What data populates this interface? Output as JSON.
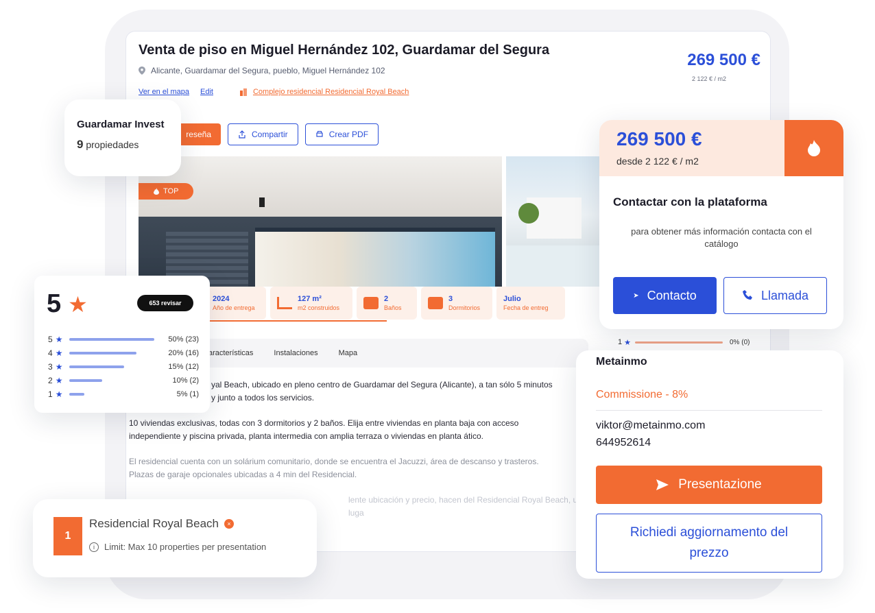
{
  "listing": {
    "title": "Venta de piso en Miguel Hernández 102, Guardamar del Segura",
    "address": "Alicante, Guardamar del Segura, pueblo, Miguel Hernández 102",
    "link_map": "Ver en el mapa",
    "link_edit": "Edit",
    "link_complex": "Complejo residencial Residencial Royal Beach",
    "price": "269 500 €",
    "price_m2": "2 122 € / m2",
    "btn_review": "reseña",
    "btn_share": "Compartir",
    "btn_pdf": "Crear PDF",
    "top_badge": "TOP"
  },
  "features": [
    {
      "value": "2024",
      "label": "Año de entrega",
      "icon": "calendar-icon"
    },
    {
      "value": "127 m²",
      "label": "m2 construidos",
      "icon": "area-icon"
    },
    {
      "value": "2",
      "label": "Baños",
      "icon": "bath-icon"
    },
    {
      "value": "3",
      "label": "Dormitorios",
      "icon": "bed-icon"
    },
    {
      "value": "Julio",
      "label": "Fecha de entreg",
      "icon": "date-icon"
    }
  ],
  "tabs": [
    "aracterísticas",
    "Instalaciones",
    "Mapa"
  ],
  "description": {
    "p1a": "yal Beach, ubicado en pleno centro de Guardamar del Segura (Alicante), a tan sólo 5 minutos",
    "p1b": "y junto a todos los servicios.",
    "p2a": "10 viviendas exclusivas, todas con 3 dormitorios y 2 baños. Elija entre viviendas en planta baja con acceso",
    "p2b": "independiente y piscina privada, planta intermedia con amplia terraza o viviendas en planta ático.",
    "p3a": "El residencial cuenta con un solárium comunitario, donde se encuentra el Jacuzzi, área de descanso y trasteros.",
    "p3b": "Plazas de garaje opcionales ubicadas a 4 min del Residencial.",
    "p4a": "lente ubicación y precio, hacen del Residencial Royal Beach, un luga"
  },
  "invest": {
    "name": "Guardamar Invest",
    "count": "9",
    "label": "propiedades"
  },
  "rating": {
    "score": "5",
    "reviews": "653 revisar",
    "rows": [
      {
        "stars": "5",
        "pct": "50%",
        "count": "(23)",
        "fraction": 0.5
      },
      {
        "stars": "4",
        "pct": "20%",
        "count": "(16)",
        "fraction": 0.2
      },
      {
        "stars": "3",
        "pct": "15%",
        "count": "(12)",
        "fraction": 0.15
      },
      {
        "stars": "2",
        "pct": "10%",
        "count": "(2)",
        "fraction": 0.1
      },
      {
        "stars": "1",
        "pct": "5%",
        "count": "(1)",
        "fraction": 0.05
      }
    ],
    "peek": {
      "stars": "1",
      "pct": "0%",
      "count": "(0)"
    }
  },
  "residencial": {
    "number": "1",
    "name": "Residencial Royal Beach",
    "limit": "Limit: Max 10 properties per presentation"
  },
  "contact": {
    "price": "269 500 €",
    "desde": "desde 2 122 € / m2",
    "title": "Contactar con la plataforma",
    "subtitle": "para obtener más información contacta con el catálogo",
    "btn_contacto": "Contacto",
    "btn_llamada": "Llamada"
  },
  "agency": {
    "name": "Metainmo",
    "commission": "Commissione - 8%",
    "email": "viktor@metainmo.com",
    "phone": "644952614",
    "btn_presentation": "Presentazione",
    "btn_update": "Richiedi aggiornamento del prezzo"
  },
  "colors": {
    "accent": "#f26b32",
    "primary": "#2b4fd8"
  }
}
